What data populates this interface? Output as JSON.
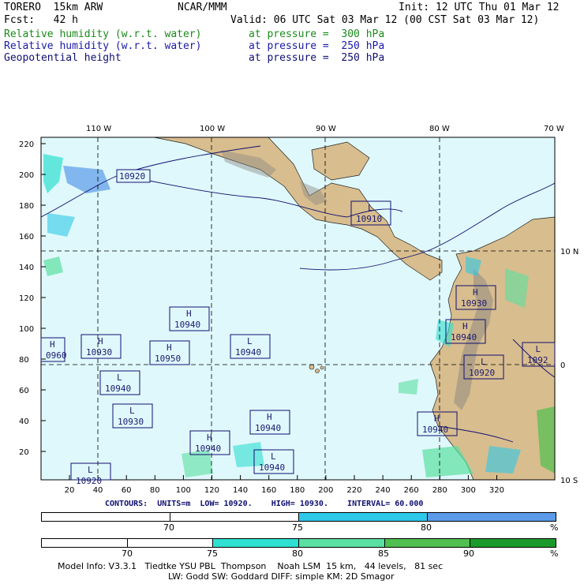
{
  "header": {
    "model": "TORERO  15km ARW",
    "org": "NCAR/MMM",
    "init": "Init: 12 UTC Thu 01 Mar 12",
    "fcst": "Fcst:   42 h",
    "valid": "Valid: 06 UTC Sat 03 Mar 12 (00 CST Sat 03 Mar 12)",
    "fields": [
      {
        "name": "Relative humidity (w.r.t. water)",
        "level": "at pressure =  300 hPa",
        "color": "#1a8a1a"
      },
      {
        "name": "Relative humidity (w.r.t. water)",
        "level": "at pressure =  250 hPa",
        "color": "#1a1aa8"
      },
      {
        "name": "Geopotential height",
        "level": "at pressure =  250 hPa",
        "color": "#101070"
      }
    ]
  },
  "map": {
    "lon_labels": [
      "110 W",
      "100 W",
      "90 W",
      "80 W",
      "70 W"
    ],
    "lat_labels": [
      "10 N",
      "0",
      "10 S"
    ],
    "y_ticks": [
      "220",
      "200",
      "180",
      "160",
      "140",
      "120",
      "100",
      "80",
      "60",
      "40",
      "20"
    ],
    "x_ticks": [
      "20",
      "40",
      "60",
      "80",
      "100",
      "120",
      "140",
      "160",
      "180",
      "200",
      "220",
      "240",
      "260",
      "280",
      "300",
      "320"
    ],
    "ocean_color": "#dff8fb",
    "land_color": "#d8bd8e",
    "centers": [
      {
        "type": "L",
        "value": "10910"
      },
      {
        "type": "H",
        "value": "10930"
      },
      {
        "type": "H",
        "value": "10940"
      },
      {
        "type": "H",
        "value": "10940"
      },
      {
        "type": "H",
        "value": "10930"
      },
      {
        "type": "H",
        "value": "10950"
      },
      {
        "type": "L",
        "value": "10940"
      },
      {
        "type": "H",
        "value": "0960"
      },
      {
        "type": "L",
        "value": "10940"
      },
      {
        "type": "L",
        "value": "10930"
      },
      {
        "type": "H",
        "value": "10940"
      },
      {
        "type": "H",
        "value": "10940"
      },
      {
        "type": "L",
        "value": "10940"
      },
      {
        "type": "L",
        "value": "10920"
      },
      {
        "type": "H",
        "value": "10940"
      },
      {
        "type": "L",
        "value": "1092"
      },
      {
        "type": "L",
        "value": "10920"
      }
    ],
    "contour_label": "10920"
  },
  "contours_line": "CONTOURS:  UNITS=m  LOW= 10920.    HIGH= 10930.    INTERVAL= 60.000",
  "colorbar_250": {
    "labels": [
      "70",
      "75",
      "80",
      "%"
    ],
    "colors": [
      "#ffffff",
      "#ffffff",
      "#2ec8e8",
      "#5a9ae8"
    ]
  },
  "colorbar_300": {
    "labels": [
      "70",
      "75",
      "80",
      "85",
      "90",
      "%"
    ],
    "colors": [
      "#ffffff",
      "#ffffff",
      "#2ee0d0",
      "#5ae0a0",
      "#50c050",
      "#1a9a2a"
    ]
  },
  "footer": {
    "line1": "Model Info: V3.3.1   Tiedtke YSU PBL  Thompson    Noah LSM  15 km,   44 levels,   81 sec",
    "line2": "LW: Godd SW: Goddard DIFF: simple KM: 2D Smagor"
  }
}
